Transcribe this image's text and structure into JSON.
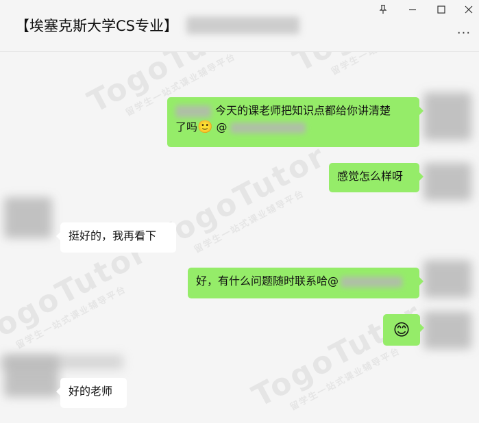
{
  "window": {
    "title": "【埃塞克斯大学CS专业】",
    "pin_icon": "pin-icon",
    "minimize_icon": "minimize-icon",
    "maximize_icon": "maximize-icon",
    "close_icon": "close-icon",
    "more_icon": "more-icon"
  },
  "messages": [
    {
      "sender": "me",
      "text_line1": "今天的课老师把知识点都给你讲清楚",
      "text_line2": "了吗",
      "emoji": "🙂"
    },
    {
      "sender": "me",
      "text": "感觉怎么样呀"
    },
    {
      "sender": "other",
      "text": "挺好的，我再看下"
    },
    {
      "sender": "me",
      "text": "好，有什么问题随时联系哈"
    },
    {
      "sender": "me",
      "emoji": "😊"
    },
    {
      "sender": "other",
      "text": "好的老师"
    }
  ],
  "watermark": {
    "brand": "TogoTutor",
    "tagline": "留学生一站式课业辅导平台"
  }
}
